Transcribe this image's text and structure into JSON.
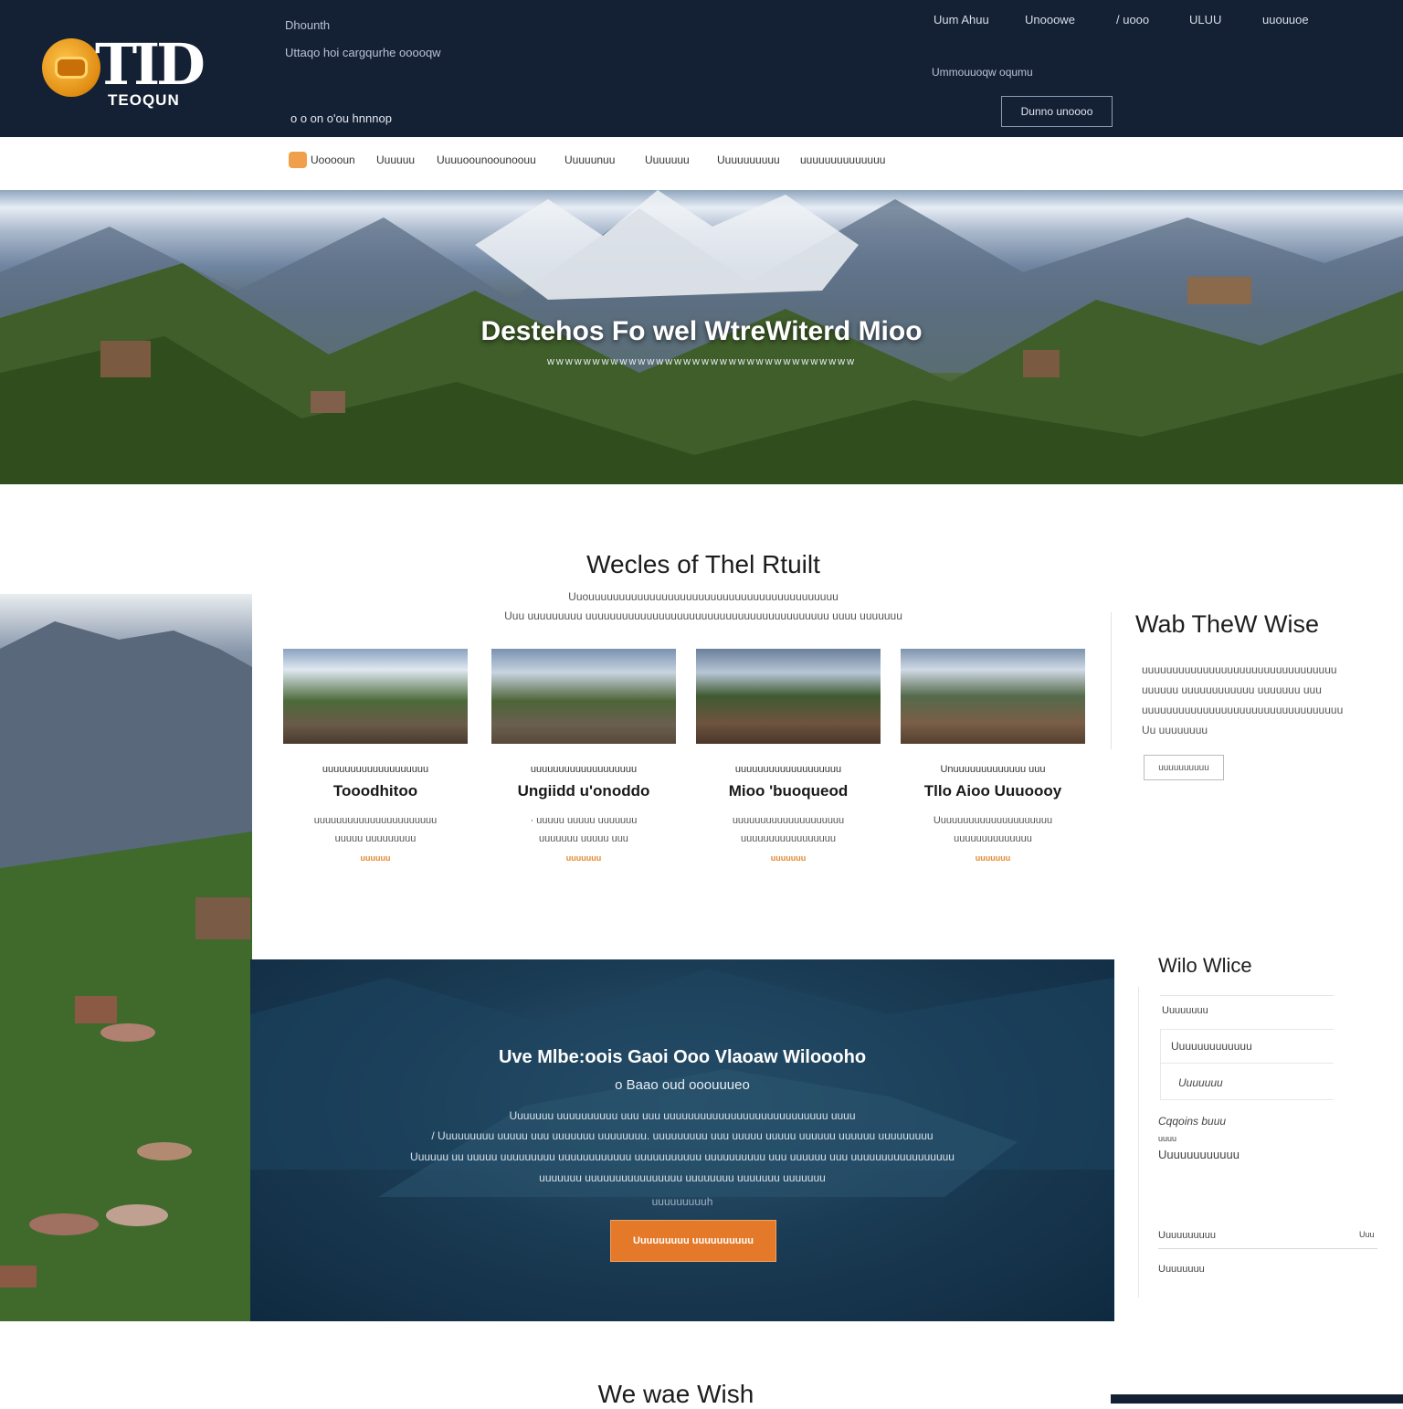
{
  "header": {
    "logo_text": "TID",
    "logo_sub": "TEOQUN",
    "tagline_1": "Dhounth",
    "tagline_2": "Uttaqo hoi cargqurhe ooooqw",
    "tagline_3": "o o on o'ou hnnnop",
    "nav": [
      "Uum Ahuu",
      "Unooowe",
      "/ uooo",
      "ULUU",
      "uuouuoe"
    ],
    "info": "Ummouuoqw oqumu",
    "button_label": "Dunno unoooo"
  },
  "subnav": {
    "items": [
      "Uooooun",
      "Uuuuuu",
      "Uuuuoounoounoouu",
      "Uuuuunuu",
      "Uuuuuuu",
      "Uuuuuuuuuu",
      "uuuuuuuuuuuuuu"
    ]
  },
  "hero": {
    "title": "Destehos Fo  wel WtreWiterd Mioo",
    "subtitle": "wwwwwwwwwwwwwwwwwwwwwwwwwwwwwwwwww"
  },
  "services": {
    "title": "Wecles of Thel Rtuilt",
    "subtitle_1": "Uuouuuuuuuuuuuuuuuuuuuuuuuuuuuuuuuuuuuuuuuuu",
    "subtitle_2": "Uuu uuuuuuuuu uuuuuuuuuuuuuuuuuuuuuuuuuuuuuuuuuuuuuuuu uuuu  uuuuuuu",
    "cards": [
      {
        "kicker": "uuuuuuuuuuuuuuuuuuu",
        "name": "Tooodhitoo",
        "desc_1": "uuuuuuuuuuuuuuuuuuuuuu",
        "desc_2": "uuuuu uuuuuuuuu",
        "more": "uuuuuu"
      },
      {
        "kicker": "uuuuuuuuuuuuuuuuuuu",
        "name": "Ungiidd u'onoddo",
        "desc_1": "· uuuuu  uuuuu uuuuuuu",
        "desc_2": "uuuuuuu uuuuu uuu",
        "more": "uuuuuuu"
      },
      {
        "kicker": "uuuuuuuuuuuuuuuuuuu",
        "name": "Mioo 'buoqueod",
        "desc_1": "uuuuuuuuuuuuuuuuuuuu",
        "desc_2": "uuuuuuuuuuuuuuuuu",
        "more": "uuuuuuu"
      },
      {
        "kicker": "Unuuuuuuuuuuuuu uuu",
        "name": "Tllo Aioo Uuuoooy",
        "desc_1": "Uuuuuuuuuuuuuuuuuuuuu",
        "desc_2": "uuuuuuuuuuuuuu",
        "more": "uuuuuuu"
      }
    ]
  },
  "sidebar_about": {
    "title": "Wab TheW Wise",
    "lines": [
      "uuuuuuuuuuuuuuuuuuuuuuuuuuuuuuuu",
      "uuuuuu uuuuuuuuuuuu uuuuuuu uuu",
      "uuuuuuuuuuuuuuuuuuuuuuuuuuuuuuuuu",
      "Uu  uuuuuuuu"
    ],
    "button_label": "uuuuuuuuuu"
  },
  "banner": {
    "title": "Uve Mlbe:oois Gaoi Ooo Vlaoaw Wiloooho",
    "subtitle": "o Baao oud ooouuueo",
    "para_1": "Uuuuuuu uuuuuuuuuu  uuu uuu uuuuuuuuuuuuuuuuuuuuuuuuuuu uuuu",
    "para_2": "/ Uuuuuuuuu uuuuu uuu uuuuuuu uuuuuuuu.  uuuuuuuuu uuu uuuuu uuuuu uuuuuu uuuuuu uuuuuuuuu",
    "para_3": "Uuuuuu uu uuuuu uuuuuuuuu uuuuuuuuuuuu uuuuuuuuuuu uuuuuuuuuu uuu uuuuuu uuu uuuuuuuuuuuuuuuuu",
    "para_4": "uuuuuuu uuuuuuuuuuuuuuuu uuuuuuuu uuuuuuu uuuuuuu",
    "note": "uuuuuuuuuh",
    "cta_label": "Uuuuuuuuu uuuuuuuuuu"
  },
  "sidebar_contact": {
    "title": "Wilo Wlice",
    "field_1": "Uuuuuuuu",
    "field_2": "Uuuuuuuuuuuuu",
    "field_3": "Uuuuuuu",
    "label": "Cqqoins buuu",
    "label_small": "uuuu",
    "value": "Uuuuuuuuuuuu",
    "footer_1": "Uuuuuuuuuu",
    "footer_1_right": "Uuu",
    "footer_2": "Uuuuuuuu"
  },
  "bottom": {
    "title": "We wae Wish"
  }
}
